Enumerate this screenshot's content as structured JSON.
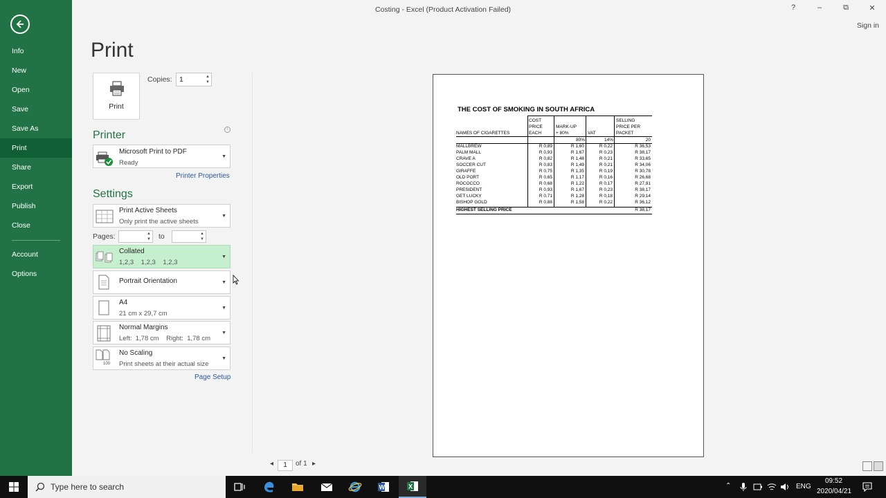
{
  "window": {
    "title": "Costing - Excel (Product Activation Failed)",
    "help": "?",
    "minimize": "–",
    "restore": "⧉",
    "close": "✕",
    "signin": "Sign in"
  },
  "sidebar": {
    "items": [
      {
        "label": "Info"
      },
      {
        "label": "New"
      },
      {
        "label": "Open"
      },
      {
        "label": "Save"
      },
      {
        "label": "Save As"
      },
      {
        "label": "Print"
      },
      {
        "label": "Share"
      },
      {
        "label": "Export"
      },
      {
        "label": "Publish"
      },
      {
        "label": "Close"
      },
      {
        "label": "Account"
      },
      {
        "label": "Options"
      }
    ]
  },
  "print": {
    "title": "Print",
    "button_label": "Print",
    "copies_label": "Copies:",
    "copies_value": "1",
    "printer_heading": "Printer",
    "printer_name": "Microsoft Print to PDF",
    "printer_status": "Ready",
    "printer_properties": "Printer Properties",
    "settings_heading": "Settings",
    "sheets_main": "Print Active Sheets",
    "sheets_sub": "Only print the active sheets",
    "pages_label": "Pages:",
    "to_label": "to",
    "collated_main": "Collated",
    "collated_sub": "1,2,3    1,2,3    1,2,3",
    "orientation": "Portrait Orientation",
    "paper_main": "A4",
    "paper_sub": "21 cm x 29,7 cm",
    "margins_main": "Normal Margins",
    "margins_sub": "Left:  1,78 cm    Right:  1,78 cm",
    "scaling_main": "No Scaling",
    "scaling_sub": "Print sheets at their actual size",
    "scaling_icon_text": "100",
    "page_setup": "Page Setup"
  },
  "preview": {
    "report_title": "THE COST OF SMOKING IN SOUTH AFRICA",
    "headers": {
      "name": "NAMES OF CIGARETTES",
      "cost": [
        "COST",
        "PRICE",
        "EACH"
      ],
      "markup": [
        "MARK-UP",
        "+ 80%"
      ],
      "vat": "VAT",
      "selling": [
        "SELLING",
        "PRICE PER",
        "PACKET"
      ]
    },
    "params": {
      "markup": "80%",
      "vat": "14%",
      "packet": "20"
    },
    "rows": [
      {
        "name": "MALLBREW",
        "cost": "R 0,89",
        "markup": "R 1,60",
        "vat": "R 0,22",
        "selling": "R 36,53"
      },
      {
        "name": "PALM MALL",
        "cost": "R 0,93",
        "markup": "R 1,67",
        "vat": "R 0,23",
        "selling": "R 38,17"
      },
      {
        "name": "CRAVE A",
        "cost": "R 0,82",
        "markup": "R 1,48",
        "vat": "R 0,21",
        "selling": "R 33,65"
      },
      {
        "name": "SOCCER CUT",
        "cost": "R 0,83",
        "markup": "R 1,49",
        "vat": "R 0,21",
        "selling": "R 34,06"
      },
      {
        "name": "GIRAFFE",
        "cost": "R 0,75",
        "markup": "R 1,35",
        "vat": "R 0,19",
        "selling": "R 30,78"
      },
      {
        "name": "OLD PORT",
        "cost": "R 0,65",
        "markup": "R 1,17",
        "vat": "R 0,16",
        "selling": "R 26,68"
      },
      {
        "name": "ROCOCCO",
        "cost": "R 0,68",
        "markup": "R 1,22",
        "vat": "R 0,17",
        "selling": "R 27,91"
      },
      {
        "name": "PRESIDENT",
        "cost": "R 0,93",
        "markup": "R 1,67",
        "vat": "R 0,23",
        "selling": "R 38,17"
      },
      {
        "name": "GET LUCKY",
        "cost": "R 0,71",
        "markup": "R 1,28",
        "vat": "R 0,18",
        "selling": "R 29,14"
      },
      {
        "name": "BISHOP GOLD",
        "cost": "R 0,88",
        "markup": "R 1,58",
        "vat": "R 0,22",
        "selling": "R 36,12"
      }
    ],
    "highest_label": "HIGHEST SELLING PRICE",
    "highest_value": "R 38,17"
  },
  "pager": {
    "current": "1",
    "total": "of 1"
  },
  "taskbar": {
    "search_placeholder": "Type here to search",
    "lang": "ENG",
    "time": "09:52",
    "date": "2020/04/21"
  },
  "colors": {
    "accent": "#217346",
    "accent_dark": "#105e33",
    "collated_highlight": "#c6efce"
  }
}
